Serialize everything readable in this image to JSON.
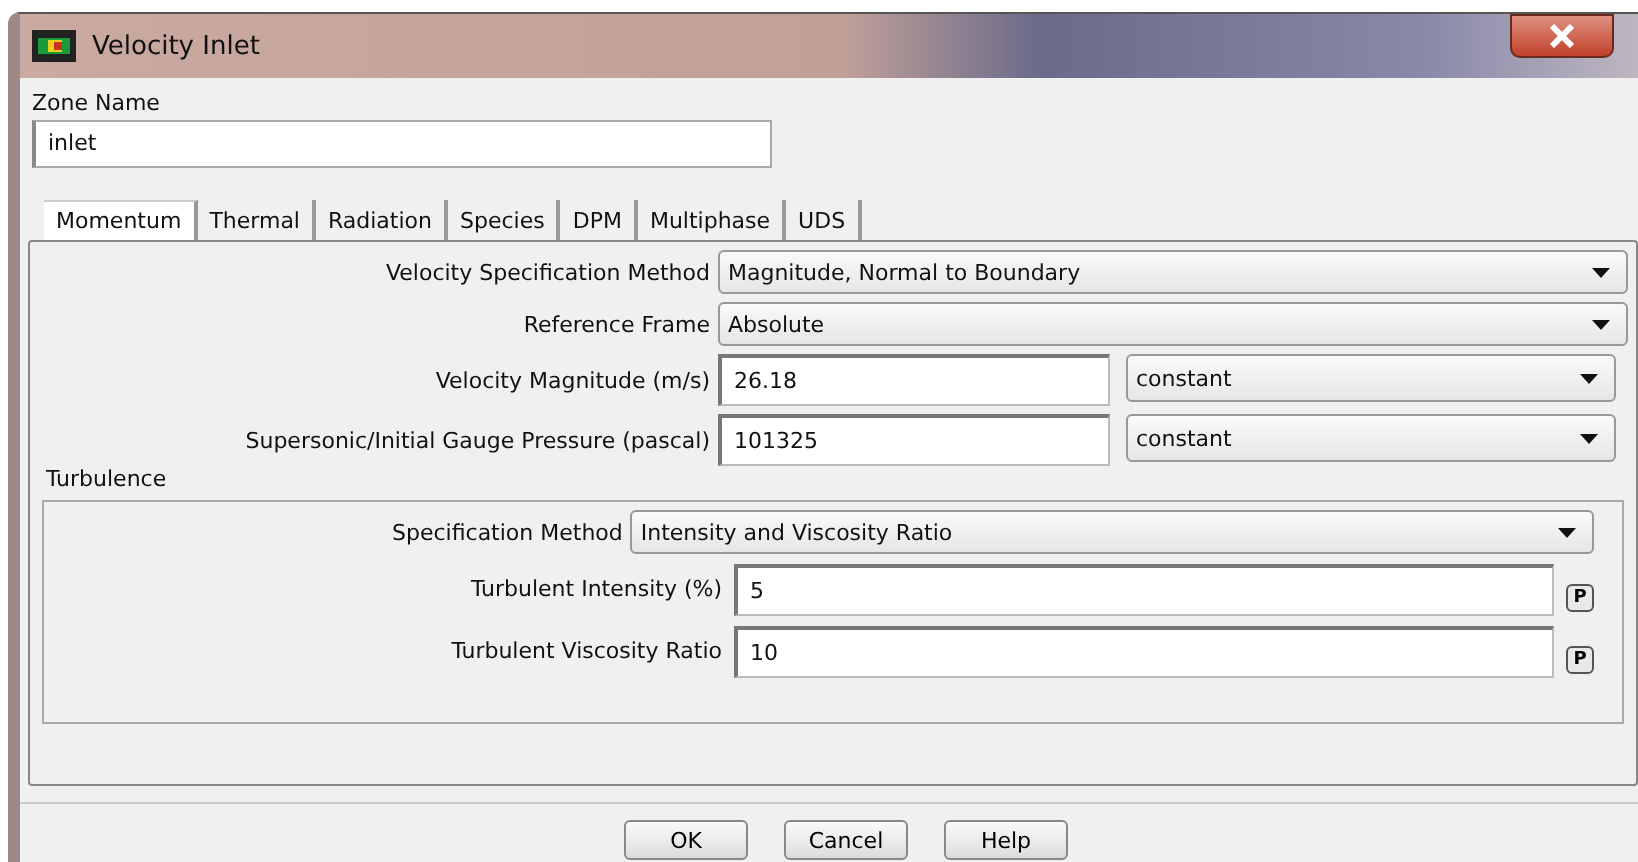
{
  "window": {
    "title": "Velocity Inlet"
  },
  "zone_name": {
    "label": "Zone Name",
    "value": "inlet"
  },
  "tabs": [
    {
      "label": "Momentum",
      "selected": true
    },
    {
      "label": "Thermal",
      "selected": false
    },
    {
      "label": "Radiation",
      "selected": false
    },
    {
      "label": "Species",
      "selected": false
    },
    {
      "label": "DPM",
      "selected": false
    },
    {
      "label": "Multiphase",
      "selected": false
    },
    {
      "label": "UDS",
      "selected": false
    }
  ],
  "fields": [
    {
      "kind": "dropdown",
      "label": "Velocity Specification Method",
      "value": "Magnitude, Normal to Boundary"
    },
    {
      "kind": "dropdown",
      "label": "Reference Frame",
      "value": "Absolute"
    },
    {
      "kind": "profile",
      "label": "Velocity Magnitude (m/s)",
      "value": "26.18",
      "profile": "constant"
    },
    {
      "kind": "profile",
      "label": "Supersonic/Initial Gauge Pressure (pascal)",
      "value": "101325",
      "profile": "constant"
    }
  ],
  "turbulence": {
    "title": "Turbulence",
    "fields": [
      {
        "kind": "dropdown",
        "label": "Specification Method",
        "value": "Intensity and Viscosity Ratio"
      },
      {
        "kind": "param",
        "label": "Turbulent Intensity (%)",
        "value": "5",
        "param": "P"
      },
      {
        "kind": "param",
        "label": "Turbulent Viscosity Ratio",
        "value": "10",
        "param": "P"
      }
    ]
  },
  "buttons": [
    "OK",
    "Cancel",
    "Help"
  ]
}
